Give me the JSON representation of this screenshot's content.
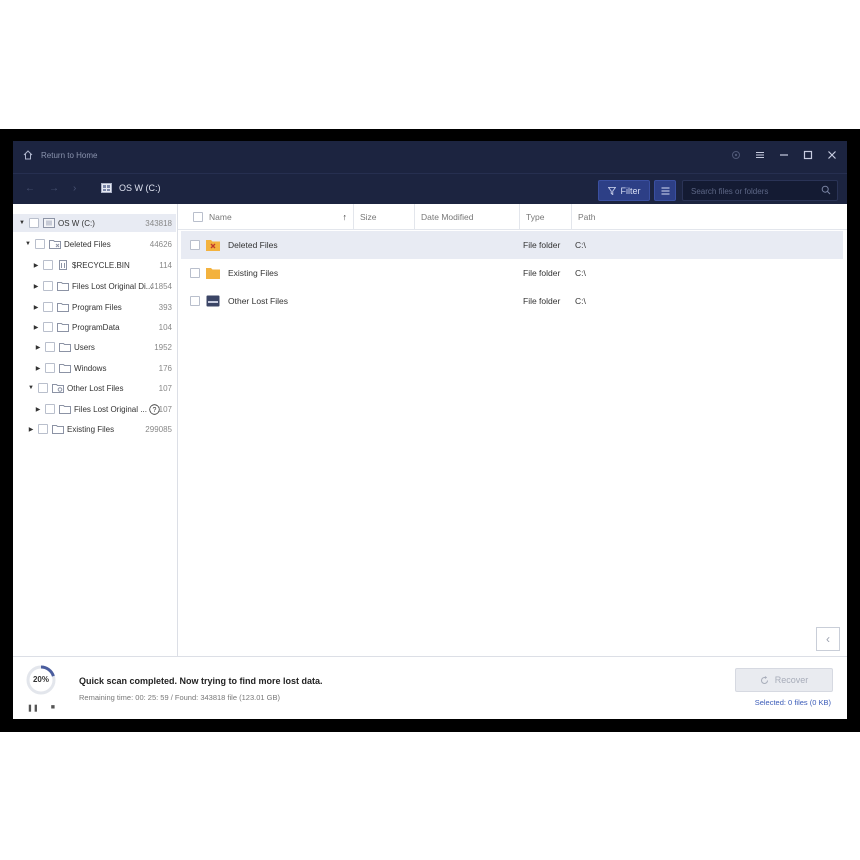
{
  "titlebar": {
    "home_label": "Return to Home",
    "controls": [
      "settings-icon",
      "menu-icon",
      "minimize-icon",
      "maximize-icon",
      "close-icon"
    ]
  },
  "toolbar": {
    "location": "OS W (C:)",
    "filter_label": "Filter",
    "search_placeholder": "Search files or folders"
  },
  "tree": {
    "items": [
      {
        "label": "OS W (C:)",
        "count": "343818"
      },
      {
        "label": "Deleted Files",
        "count": "44626"
      },
      {
        "label": "$RECYCLE.BIN",
        "count": "114"
      },
      {
        "label": "Files Lost Original Di...",
        "count": "41854"
      },
      {
        "label": "Program Files",
        "count": "393"
      },
      {
        "label": "ProgramData",
        "count": "104"
      },
      {
        "label": "Users",
        "count": "1952"
      },
      {
        "label": "Windows",
        "count": "176"
      },
      {
        "label": "Other Lost Files",
        "count": "107"
      },
      {
        "label": "Files Lost Original ...",
        "count": "107"
      },
      {
        "label": "Existing Files",
        "count": "299085"
      }
    ]
  },
  "table": {
    "columns": [
      "Name",
      "Size",
      "Date Modified",
      "Type",
      "Path"
    ],
    "sort_arrow": "↑",
    "rows": [
      {
        "name": "Deleted Files",
        "size": "",
        "date": "",
        "type": "File folder",
        "path": "C:\\"
      },
      {
        "name": "Existing Files",
        "size": "",
        "date": "",
        "type": "File folder",
        "path": "C:\\"
      },
      {
        "name": "Other Lost Files",
        "size": "",
        "date": "",
        "type": "File folder",
        "path": "C:\\"
      }
    ]
  },
  "status": {
    "progress_percent": 20,
    "progress_label": "20%",
    "message": "Quick scan completed. Now trying to find more lost data.",
    "details": "Remaining time: 00: 25: 59 / Found: 343818 file (123.01 GB)",
    "recover_label": "Recover",
    "selected": "Selected: 0 files (0 KB)"
  },
  "colors": {
    "titlebar": "#1c2440",
    "accent": "#2d3f86",
    "link": "#3a5bb8"
  }
}
